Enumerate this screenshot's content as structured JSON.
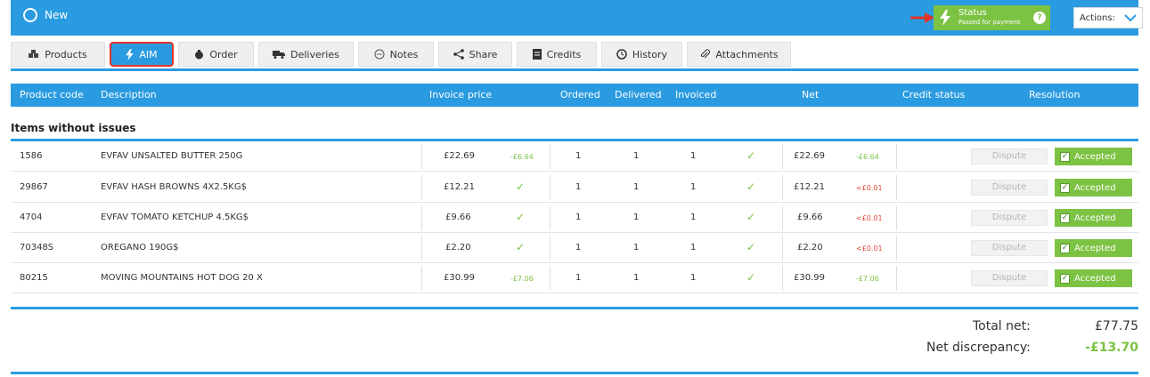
{
  "topbar": {
    "new_label": "New",
    "status_title": "Status",
    "status_subtitle": "Passed for payment",
    "status_help": "?",
    "actions_label": "Actions:"
  },
  "tabs": [
    {
      "label": "Products",
      "icon": "boxes-icon"
    },
    {
      "label": "AIM",
      "icon": "bolt-icon"
    },
    {
      "label": "Order",
      "icon": "order-icon"
    },
    {
      "label": "Deliveries",
      "icon": "truck-icon"
    },
    {
      "label": "Notes",
      "icon": "chat-icon"
    },
    {
      "label": "Share",
      "icon": "share-icon"
    },
    {
      "label": "Credits",
      "icon": "document-icon"
    },
    {
      "label": "History",
      "icon": "clock-icon"
    },
    {
      "label": "Attachments",
      "icon": "paperclip-icon"
    }
  ],
  "columns": {
    "product_code": "Product code",
    "description": "Description",
    "invoice_price": "Invoice price",
    "ordered": "Ordered",
    "delivered": "Delivered",
    "invoiced": "Invoiced",
    "net": "Net",
    "credit_status": "Credit status",
    "resolution": "Resolution"
  },
  "section_title": "Items without issues",
  "rows": [
    {
      "code": "1586",
      "desc": "EVFAV UNSALTED BUTTER 250G",
      "price": "£22.69",
      "price_diff": "-£6.64",
      "ordered": "1",
      "delivered": "1",
      "invoiced": "1",
      "net": "£22.69",
      "net_diff": "-£6.64",
      "dispute": "Dispute",
      "accepted": "Accepted"
    },
    {
      "code": "29867",
      "desc": "EVFAV HASH BROWNS 4X2.5KG$",
      "price": "£12.21",
      "price_diff": "",
      "ordered": "1",
      "delivered": "1",
      "invoiced": "1",
      "net": "£12.21",
      "net_diff": "<£0.01",
      "dispute": "Dispute",
      "accepted": "Accepted"
    },
    {
      "code": "4704",
      "desc": "EVFAV TOMATO KETCHUP 4.5KG$",
      "price": "£9.66",
      "price_diff": "",
      "ordered": "1",
      "delivered": "1",
      "invoiced": "1",
      "net": "£9.66",
      "net_diff": "<£0.01",
      "dispute": "Dispute",
      "accepted": "Accepted"
    },
    {
      "code": "70348S",
      "desc": "OREGANO 190G$",
      "price": "£2.20",
      "price_diff": "",
      "ordered": "1",
      "delivered": "1",
      "invoiced": "1",
      "net": "£2.20",
      "net_diff": "<£0.01",
      "dispute": "Dispute",
      "accepted": "Accepted"
    },
    {
      "code": "80215",
      "desc": "MOVING MOUNTAINS HOT DOG 20 X",
      "price": "£30.99",
      "price_diff": "-£7.06",
      "ordered": "1",
      "delivered": "1",
      "invoiced": "1",
      "net": "£30.99",
      "net_diff": "-£7.06",
      "dispute": "Dispute",
      "accepted": "Accepted"
    }
  ],
  "totals": {
    "total_net_label": "Total net:",
    "total_net_value": "£77.75",
    "net_discrepancy_label": "Net discrepancy:",
    "net_discrepancy_value": "-£13.70"
  },
  "colors": {
    "primary": "#2a9be0",
    "success": "#7cc243",
    "danger": "#e04a3a",
    "highlight": "#e0342a"
  }
}
